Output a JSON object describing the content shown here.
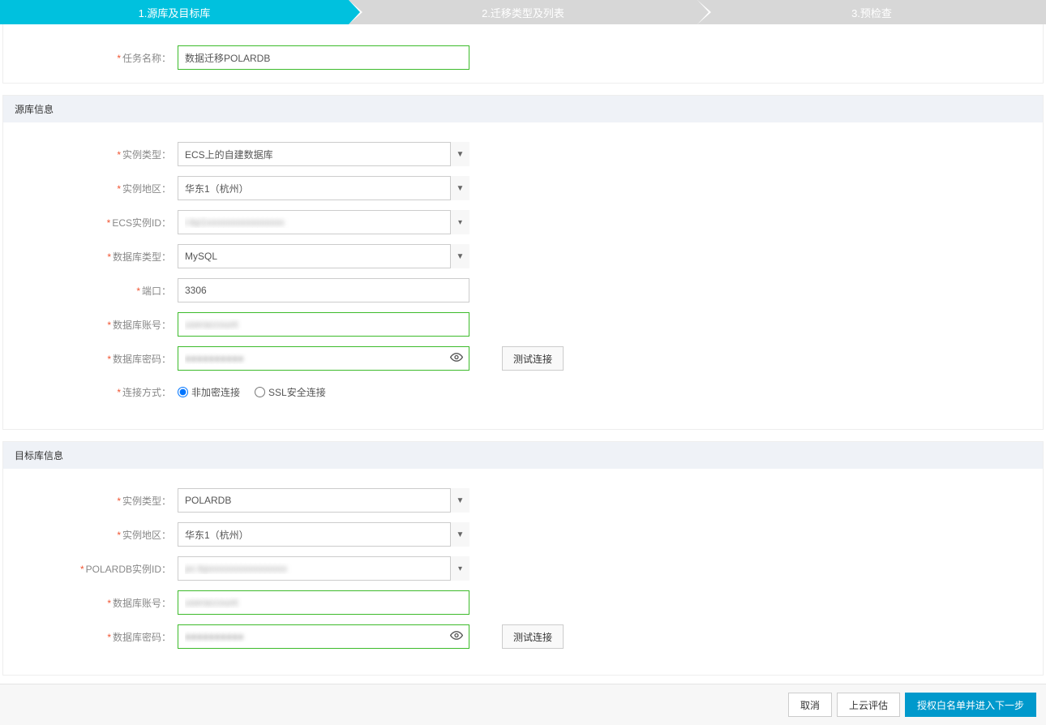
{
  "stepper": {
    "step1": "1.源库及目标库",
    "step2": "2.迁移类型及列表",
    "step3": "3.预检查"
  },
  "task": {
    "label": "任务名称：",
    "value": "数据迁移POLARDB"
  },
  "source": {
    "header": "源库信息",
    "instanceType": {
      "label": "实例类型：",
      "value": "ECS上的自建数据库"
    },
    "region": {
      "label": "实例地区：",
      "value": "华东1（杭州）"
    },
    "ecsId": {
      "label": "ECS实例ID：",
      "value": "i-bp1xxxxxxxxxxxxxxxx"
    },
    "dbType": {
      "label": "数据库类型：",
      "value": "MySQL"
    },
    "port": {
      "label": "端口：",
      "value": "3306"
    },
    "account": {
      "label": "数据库账号：",
      "value": "useraccount"
    },
    "password": {
      "label": "数据库密码：",
      "value": "●●●●●●●●●●"
    },
    "conn": {
      "label": "连接方式：",
      "opt1": "非加密连接",
      "opt2": "SSL安全连接"
    },
    "testBtn": "测试连接"
  },
  "target": {
    "header": "目标库信息",
    "instanceType": {
      "label": "实例类型：",
      "value": "POLARDB"
    },
    "region": {
      "label": "实例地区：",
      "value": "华东1（杭州）"
    },
    "polardbId": {
      "label": "POLARDB实例ID：",
      "value": "pc-bpxxxxxxxxxxxxxxxx"
    },
    "account": {
      "label": "数据库账号：",
      "value": "useraccount"
    },
    "password": {
      "label": "数据库密码：",
      "value": "●●●●●●●●●●"
    },
    "testBtn": "测试连接"
  },
  "footer": {
    "cancel": "取消",
    "evaluate": "上云评估",
    "next": "授权白名单并进入下一步"
  }
}
